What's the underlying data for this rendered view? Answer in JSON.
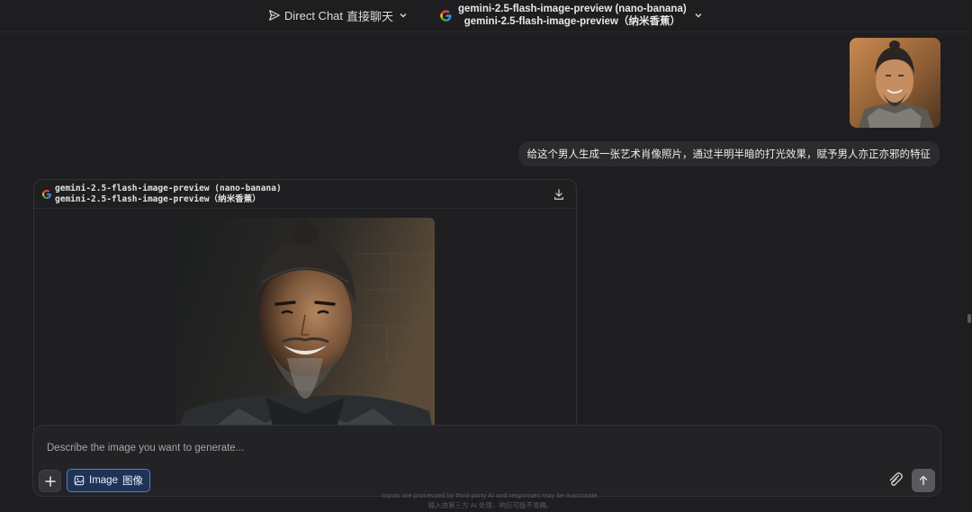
{
  "topbar": {
    "mode_label": "Direct Chat",
    "mode_label_cn": "直接聊天",
    "model_line1": "gemini-2.5-flash-image-preview (nano-banana)",
    "model_line2": "gemini-2.5-flash-image-preview（纳米香蕉）"
  },
  "user_message": {
    "text": "给这个男人生成一张艺术肖像照片，通过半明半暗的打光效果，赋予男人亦正亦邪的特征"
  },
  "assistant": {
    "model_line1": "gemini-2.5-flash-image-preview (nano-banana)",
    "model_line2": "gemini-2.5-flash-image-preview（纳米香蕉）"
  },
  "composer": {
    "placeholder": "Describe the image you want to generate...",
    "chip_label": "Image",
    "chip_label_cn": "图像"
  },
  "disclaimer": {
    "line1": "Inputs are processed by third-party AI and responses may be inaccurate.",
    "line2": "输入由第三方 AI 处理，响应可能不准确。"
  },
  "icons": {
    "mode": "send-icon",
    "provider": "google-icon",
    "download": "download-icon",
    "add": "plus-icon",
    "image": "image-icon",
    "attach": "paperclip-icon",
    "send": "arrow-up-icon"
  },
  "colors": {
    "background": "#1e1e20",
    "accent": "#4b7fd0",
    "chip_bg": "#1f3356"
  }
}
